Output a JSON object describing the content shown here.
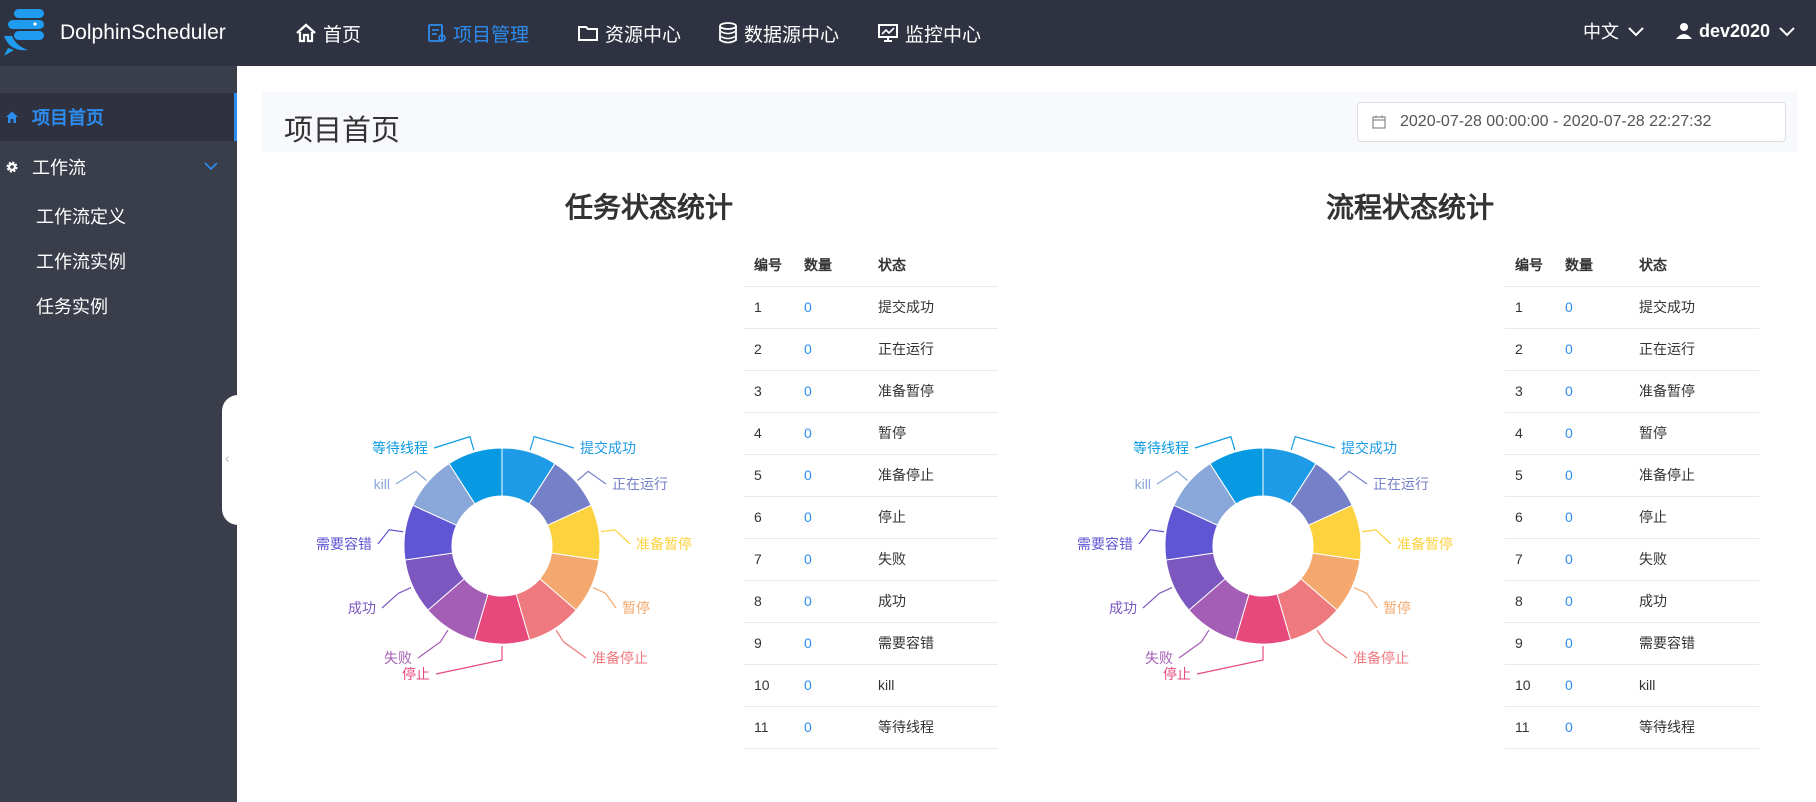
{
  "app": {
    "brand": "DolphinScheduler"
  },
  "nav": [
    {
      "label": "首页",
      "icon": "home-icon"
    },
    {
      "label": "项目管理",
      "icon": "project-icon",
      "active": true
    },
    {
      "label": "资源中心",
      "icon": "folder-icon"
    },
    {
      "label": "数据源中心",
      "icon": "database-icon"
    },
    {
      "label": "监控中心",
      "icon": "monitor-icon"
    }
  ],
  "language": "中文",
  "user": "dev2020",
  "sidebar": {
    "home": "项目首页",
    "workflow": "工作流",
    "sub": [
      "工作流定义",
      "工作流实例",
      "任务实例"
    ]
  },
  "main": {
    "title": "项目首页",
    "daterange": "2020-07-28 00:00:00 - 2020-07-28 22:27:32"
  },
  "colors": {
    "accent": "#2d8cf0",
    "topbar": "#2f3341",
    "sidebar": "#3a3d4a"
  },
  "table_headers": [
    "编号",
    "数量",
    "状态"
  ],
  "states": [
    {
      "label": "提交成功",
      "color": "#1e9be6"
    },
    {
      "label": "正在运行",
      "color": "#7580c8"
    },
    {
      "label": "准备暂停",
      "color": "#fdd23f"
    },
    {
      "label": "暂停",
      "color": "#f4a86e"
    },
    {
      "label": "准备停止",
      "color": "#ee7a80"
    },
    {
      "label": "停止",
      "color": "#e8497c"
    },
    {
      "label": "失败",
      "color": "#a45eb5"
    },
    {
      "label": "成功",
      "color": "#7b57bf"
    },
    {
      "label": "需要容错",
      "color": "#6056d3"
    },
    {
      "label": "kill",
      "color": "#89a7d8"
    },
    {
      "label": "等待线程",
      "color": "#079ae3"
    }
  ],
  "task_stats": {
    "title": "任务状态统计",
    "rows": [
      {
        "no": "1",
        "count": "0",
        "state": "提交成功"
      },
      {
        "no": "2",
        "count": "0",
        "state": "正在运行"
      },
      {
        "no": "3",
        "count": "0",
        "state": "准备暂停"
      },
      {
        "no": "4",
        "count": "0",
        "state": "暂停"
      },
      {
        "no": "5",
        "count": "0",
        "state": "准备停止"
      },
      {
        "no": "6",
        "count": "0",
        "state": "停止"
      },
      {
        "no": "7",
        "count": "0",
        "state": "失败"
      },
      {
        "no": "8",
        "count": "0",
        "state": "成功"
      },
      {
        "no": "9",
        "count": "0",
        "state": "需要容错"
      },
      {
        "no": "10",
        "count": "0",
        "state": "kill"
      },
      {
        "no": "11",
        "count": "0",
        "state": "等待线程"
      }
    ]
  },
  "process_stats": {
    "title": "流程状态统计",
    "rows": [
      {
        "no": "1",
        "count": "0",
        "state": "提交成功"
      },
      {
        "no": "2",
        "count": "0",
        "state": "正在运行"
      },
      {
        "no": "3",
        "count": "0",
        "state": "准备暂停"
      },
      {
        "no": "4",
        "count": "0",
        "state": "暂停"
      },
      {
        "no": "5",
        "count": "0",
        "state": "准备停止"
      },
      {
        "no": "6",
        "count": "0",
        "state": "停止"
      },
      {
        "no": "7",
        "count": "0",
        "state": "失败"
      },
      {
        "no": "8",
        "count": "0",
        "state": "成功"
      },
      {
        "no": "9",
        "count": "0",
        "state": "需要容错"
      },
      {
        "no": "10",
        "count": "0",
        "state": "kill"
      },
      {
        "no": "11",
        "count": "0",
        "state": "等待线程"
      }
    ]
  },
  "chart_data": [
    {
      "type": "pie",
      "categories": [
        "提交成功",
        "正在运行",
        "准备暂停",
        "暂停",
        "准备停止",
        "停止",
        "失败",
        "成功",
        "需要容错",
        "kill",
        "等待线程"
      ],
      "values": [
        0,
        0,
        0,
        0,
        0,
        0,
        0,
        0,
        0,
        0,
        0
      ],
      "title": "任务状态统计"
    },
    {
      "type": "pie",
      "categories": [
        "提交成功",
        "正在运行",
        "准备暂停",
        "暂停",
        "准备停止",
        "停止",
        "失败",
        "成功",
        "需要容错",
        "kill",
        "等待线程"
      ],
      "values": [
        0,
        0,
        0,
        0,
        0,
        0,
        0,
        0,
        0,
        0,
        0
      ],
      "title": "流程状态统计"
    }
  ]
}
